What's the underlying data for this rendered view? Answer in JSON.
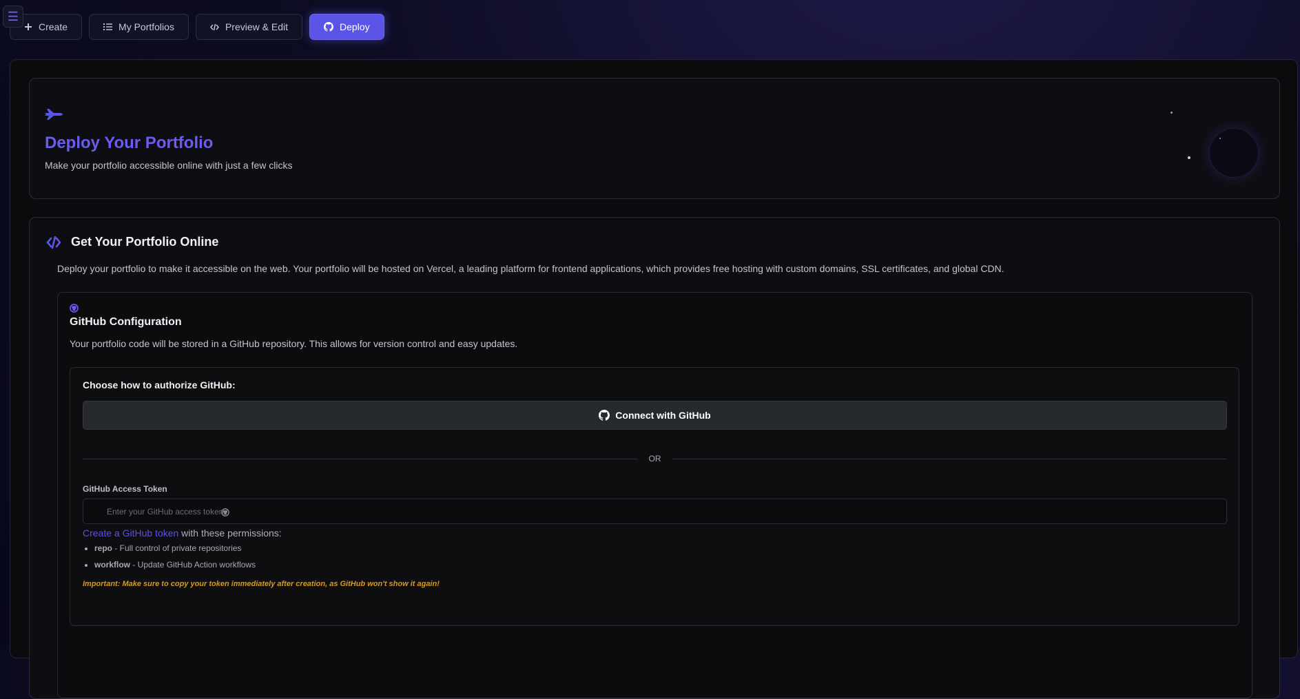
{
  "nav": {
    "tabs": [
      {
        "label": "Create",
        "icon": "plus-icon"
      },
      {
        "label": "My Portfolios",
        "icon": "list-icon"
      },
      {
        "label": "Preview & Edit",
        "icon": "code-icon"
      },
      {
        "label": "Deploy",
        "icon": "github-icon",
        "active": true
      }
    ]
  },
  "hero": {
    "title": "Deploy Your Portfolio",
    "subtitle": "Make your portfolio accessible online with just a few clicks"
  },
  "section": {
    "title": "Get Your Portfolio Online",
    "description": "Deploy your portfolio to make it accessible on the web. Your portfolio will be hosted on Vercel, a leading platform for frontend applications, which provides free hosting with custom domains, SSL certificates, and global CDN."
  },
  "github_config": {
    "title": "GitHub Configuration",
    "description": "Your portfolio code will be stored in a GitHub repository. This allows for version control and easy updates.",
    "auth_heading": "Choose how to authorize GitHub:",
    "connect_label": "Connect with GitHub",
    "or_label": "OR",
    "token_label": "GitHub Access Token",
    "token_placeholder": "Enter your GitHub access token",
    "token_value": "",
    "create_token_link": "Create a GitHub token",
    "create_token_suffix": " with these permissions:",
    "permissions": [
      {
        "name": "repo",
        "desc": " - Full control of private repositories"
      },
      {
        "name": "workflow",
        "desc": " - Update GitHub Action workflows"
      }
    ],
    "important_note": "Important: Make sure to copy your token immediately after creation, as GitHub won't show it again!"
  },
  "colors": {
    "accent": "#5b54e8",
    "warning": "#d99a1c"
  }
}
